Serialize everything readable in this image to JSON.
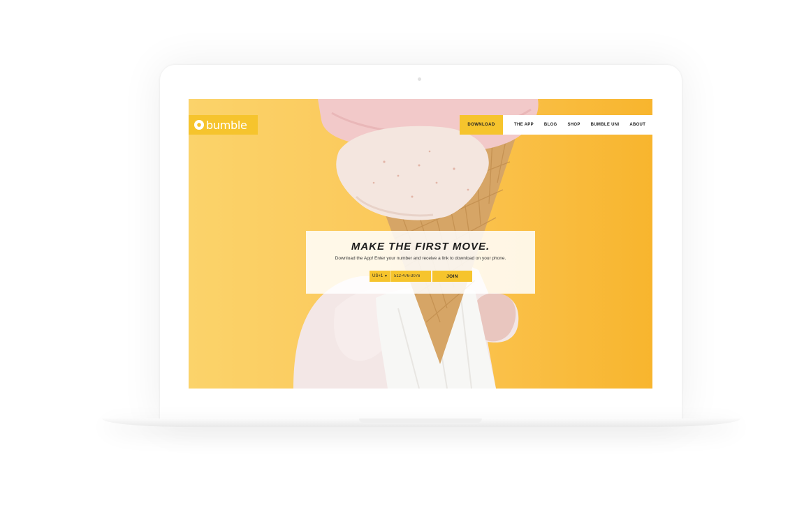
{
  "brand": {
    "name": "bumble",
    "accent": "#f6c42d",
    "logo_icon": "hexagon-logo-icon"
  },
  "nav": {
    "download": "DOWNLOAD",
    "items": [
      "THE APP",
      "BLOG",
      "SHOP",
      "BUMBLE UNI",
      "ABOUT"
    ]
  },
  "hero": {
    "headline": "MAKE THE FIRST MOVE.",
    "subline": "Download the App! Enter your number and receive a link to download on your phone."
  },
  "signup": {
    "country_code": "US+1",
    "country_icon": "caret-down-icon",
    "phone_value": "512-476-3076",
    "join_label": "JOIN"
  }
}
